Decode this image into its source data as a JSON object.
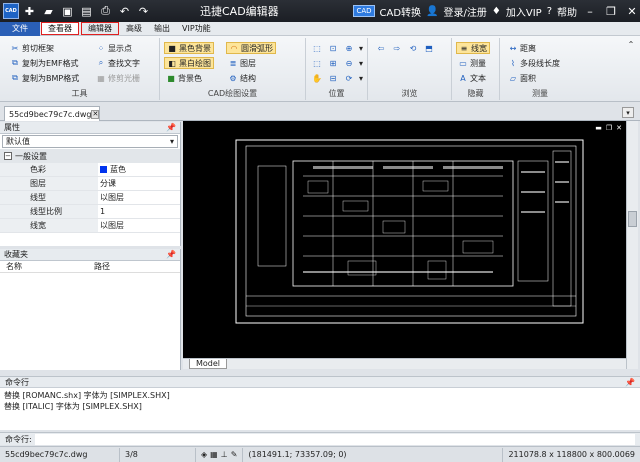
{
  "titlebar": {
    "title": "迅捷CAD编辑器",
    "cad_convert": "CAD转换",
    "cad_badge": "CAD",
    "login": "登录/注册",
    "vip": "加入VIP",
    "help": "帮助"
  },
  "menu": {
    "file": "文件",
    "viewer": "查看器",
    "editor": "编辑器",
    "advanced": "高级",
    "output": "输出",
    "vip_features": "VIP功能"
  },
  "ribbon": {
    "tools": {
      "label": "工具",
      "items": [
        "剪切框架",
        "复制为EMF格式",
        "复制为BMP格式",
        "显示点",
        "查找文字",
        "修剪光栅"
      ]
    },
    "draw_settings": {
      "label": "CAD绘图设置",
      "items": [
        "黑色背景",
        "黑白绘图",
        "背景色",
        "圆滑弧形",
        "图层",
        "结构"
      ]
    },
    "position": {
      "label": "位置"
    },
    "browse": {
      "label": "浏览"
    },
    "hide": {
      "label": "隐藏",
      "items": [
        "线宽",
        "测量",
        "文本"
      ]
    },
    "measure": {
      "label": "测量",
      "items": [
        "距离",
        "多段线长度",
        "面积"
      ]
    }
  },
  "doc_tab": {
    "name": "55cd9bec79c7c.dwg"
  },
  "properties": {
    "header": "属性",
    "selector": "默认值",
    "section": "一般设置",
    "rows": [
      {
        "key": "色彩",
        "value": "蓝色"
      },
      {
        "key": "图层",
        "value": "分课"
      },
      {
        "key": "线型",
        "value": "以图层"
      },
      {
        "key": "线型比例",
        "value": "1"
      },
      {
        "key": "线宽",
        "value": "以图层"
      }
    ]
  },
  "favorites": {
    "header": "收藏夹",
    "columns": [
      "名称",
      "路径"
    ]
  },
  "viewport": {
    "model_tab": "Model"
  },
  "command": {
    "header": "命令行",
    "lines": [
      "替换 [ROMANC.shx] 字体为 [SIMPLEX.SHX]",
      "替换 [ITALIC] 字体为 [SIMPLEX.SHX]"
    ],
    "input_label": "命令行:"
  },
  "status": {
    "file": "55cd9bec79c7c.dwg",
    "page": "3/8",
    "coords": "(181491.1; 73357.09; 0)",
    "size": "211078.8 x 118800 x 800.0069"
  },
  "colors": {
    "file_tab": "#2a5fb6",
    "highlight": "#e02020",
    "title_bg": "#1b1e24"
  }
}
